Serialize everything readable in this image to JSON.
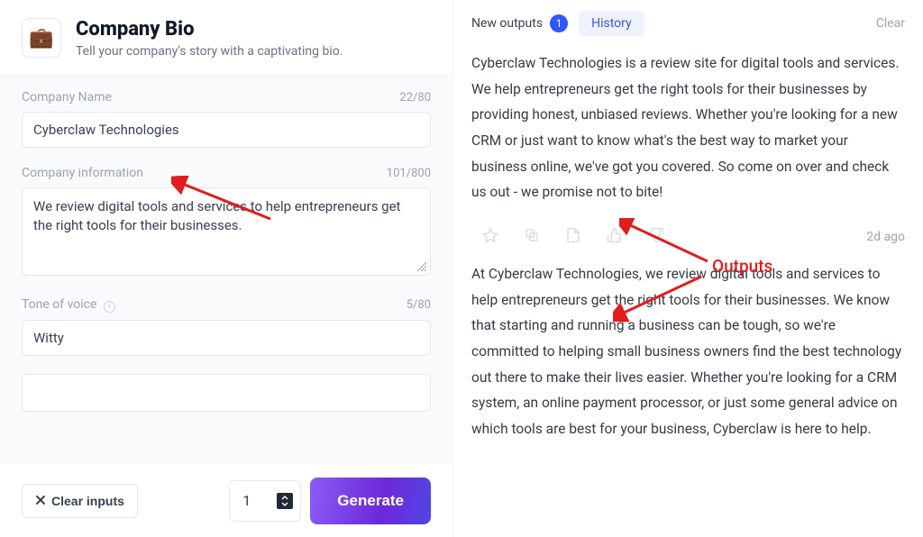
{
  "header": {
    "icon": "💼",
    "title": "Company Bio",
    "subtitle": "Tell your company's story with a captivating bio."
  },
  "form": {
    "company_name": {
      "label": "Company Name",
      "value": "Cyberclaw Technologies",
      "count": "22/80"
    },
    "company_info": {
      "label": "Company information",
      "value": "We review digital tools and services to help entrepreneurs get the right tools for their businesses.",
      "count": "101/800"
    },
    "tone": {
      "label": "Tone of voice",
      "value": "Witty",
      "count": "5/80"
    }
  },
  "bottom": {
    "clear_label": "Clear inputs",
    "qty": "1",
    "generate_label": "Generate"
  },
  "tabs": {
    "new_label": "New outputs",
    "new_count": "1",
    "history_label": "History",
    "clear_label": "Clear"
  },
  "outputs": [
    {
      "text": "Cyberclaw Technologies is a review site for digital tools and services. We help entrepreneurs get the right tools for their businesses by providing honest, unbiased reviews. Whether you're looking for a new CRM or just want to know what's the best way to market your business online, we've got you covered. So come on over and check us out - we promise not to bite!",
      "timestamp": "2d ago"
    },
    {
      "text": "At Cyberclaw Technologies, we review digital tools and services to help entrepreneurs get the right tools for their businesses. We know that starting and running a business can be tough, so we're committed to helping small business owners find the best technology out there to make their lives easier. Whether you're looking for a CRM system, an online payment processor, or just some general advice on which tools are best for your business, Cyberclaw is here to help.",
      "timestamp": ""
    }
  ],
  "annotation": {
    "label": "Outputs"
  }
}
